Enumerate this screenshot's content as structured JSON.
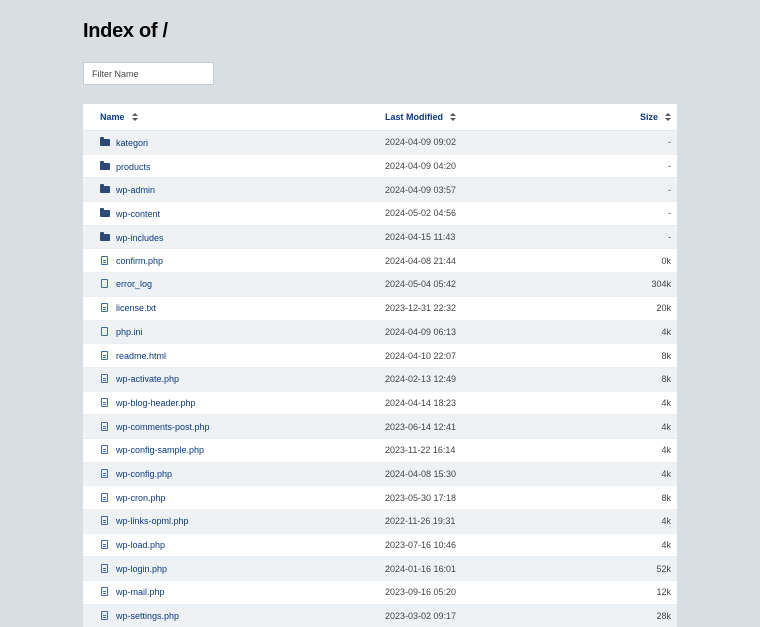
{
  "title": "Index of /",
  "filter": {
    "placeholder": "Filter Name"
  },
  "columns": {
    "name": "Name",
    "modified": "Last Modified",
    "size": "Size"
  },
  "icons": {
    "folder": "folder-icon",
    "file": "file-icon",
    "text_file": "text-file-icon",
    "sort": "sort-icon"
  },
  "entries": [
    {
      "name": "kategori",
      "modified": "2024-04-09 09:02",
      "size": "-",
      "type": "folder"
    },
    {
      "name": "products",
      "modified": "2024-04-09 04:20",
      "size": "-",
      "type": "folder"
    },
    {
      "name": "wp-admin",
      "modified": "2024-04-09 03:57",
      "size": "-",
      "type": "folder"
    },
    {
      "name": "wp-content",
      "modified": "2024-05-02 04:56",
      "size": "-",
      "type": "folder"
    },
    {
      "name": "wp-includes",
      "modified": "2024-04-15 11:43",
      "size": "-",
      "type": "folder"
    },
    {
      "name": "confirm.php",
      "modified": "2024-04-08 21:44",
      "size": "0k",
      "type": "text"
    },
    {
      "name": "error_log",
      "modified": "2024-05-04 05:42",
      "size": "304k",
      "type": "file"
    },
    {
      "name": "license.txt",
      "modified": "2023-12-31 22:32",
      "size": "20k",
      "type": "text"
    },
    {
      "name": "php.ini",
      "modified": "2024-04-09 06:13",
      "size": "4k",
      "type": "file"
    },
    {
      "name": "readme.html",
      "modified": "2024-04-10 22:07",
      "size": "8k",
      "type": "text"
    },
    {
      "name": "wp-activate.php",
      "modified": "2024-02-13 12:49",
      "size": "8k",
      "type": "text"
    },
    {
      "name": "wp-blog-header.php",
      "modified": "2024-04-14 18:23",
      "size": "4k",
      "type": "text"
    },
    {
      "name": "wp-comments-post.php",
      "modified": "2023-06-14 12:41",
      "size": "4k",
      "type": "text"
    },
    {
      "name": "wp-config-sample.php",
      "modified": "2023-11-22 16:14",
      "size": "4k",
      "type": "text"
    },
    {
      "name": "wp-config.php",
      "modified": "2024-04-08 15:30",
      "size": "4k",
      "type": "text"
    },
    {
      "name": "wp-cron.php",
      "modified": "2023-05-30 17:18",
      "size": "8k",
      "type": "text"
    },
    {
      "name": "wp-links-opml.php",
      "modified": "2022-11-26 19:31",
      "size": "4k",
      "type": "text"
    },
    {
      "name": "wp-load.php",
      "modified": "2023-07-16 10:46",
      "size": "4k",
      "type": "text"
    },
    {
      "name": "wp-login.php",
      "modified": "2024-01-16 16:01",
      "size": "52k",
      "type": "text"
    },
    {
      "name": "wp-mail.php",
      "modified": "2023-09-16 05:20",
      "size": "12k",
      "type": "text"
    },
    {
      "name": "wp-settings.php",
      "modified": "2023-03-02 09:17",
      "size": "28k",
      "type": "text"
    }
  ]
}
